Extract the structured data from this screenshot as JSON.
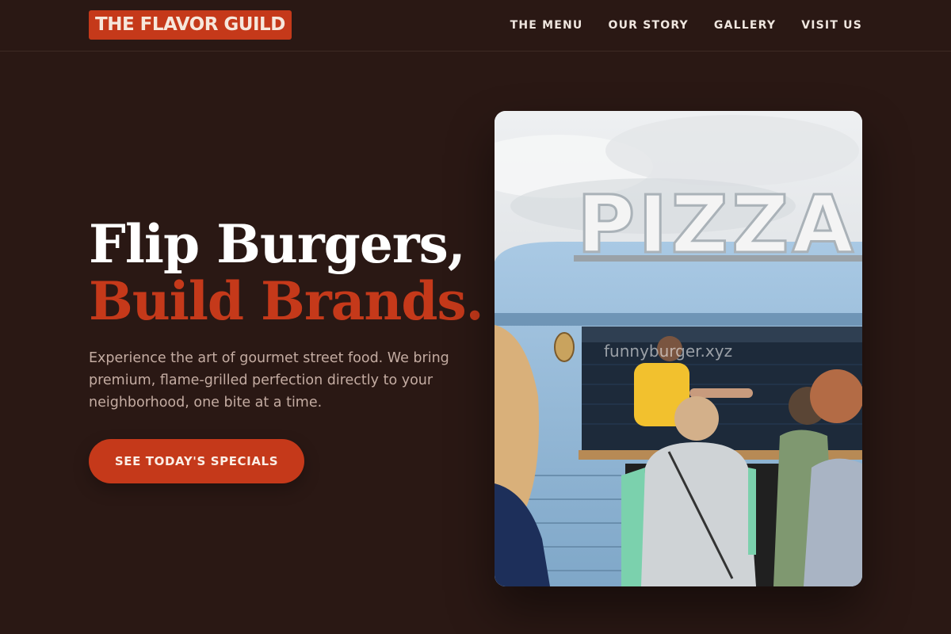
{
  "brand": {
    "logo_text": "THE FLAVOR GUILD"
  },
  "nav": {
    "items": [
      {
        "label": "THE MENU"
      },
      {
        "label": "OUR STORY"
      },
      {
        "label": "GALLERY"
      },
      {
        "label": "VISIT US"
      }
    ]
  },
  "hero": {
    "title_line1": "Flip Burgers,",
    "title_line2": "Build Brands.",
    "subtitle": "Experience the art of gourmet street food. We bring premium, flame-grilled perfection directly to your neighborhood, one bite at a time.",
    "cta_label": "SEE TODAY'S SPECIALS"
  },
  "photo": {
    "sign_text": "PIZZA",
    "watermark": "funnyburger.xyz"
  },
  "colors": {
    "background": "#2a1814",
    "accent": "#c5391a",
    "muted_text": "#c4aca2"
  }
}
